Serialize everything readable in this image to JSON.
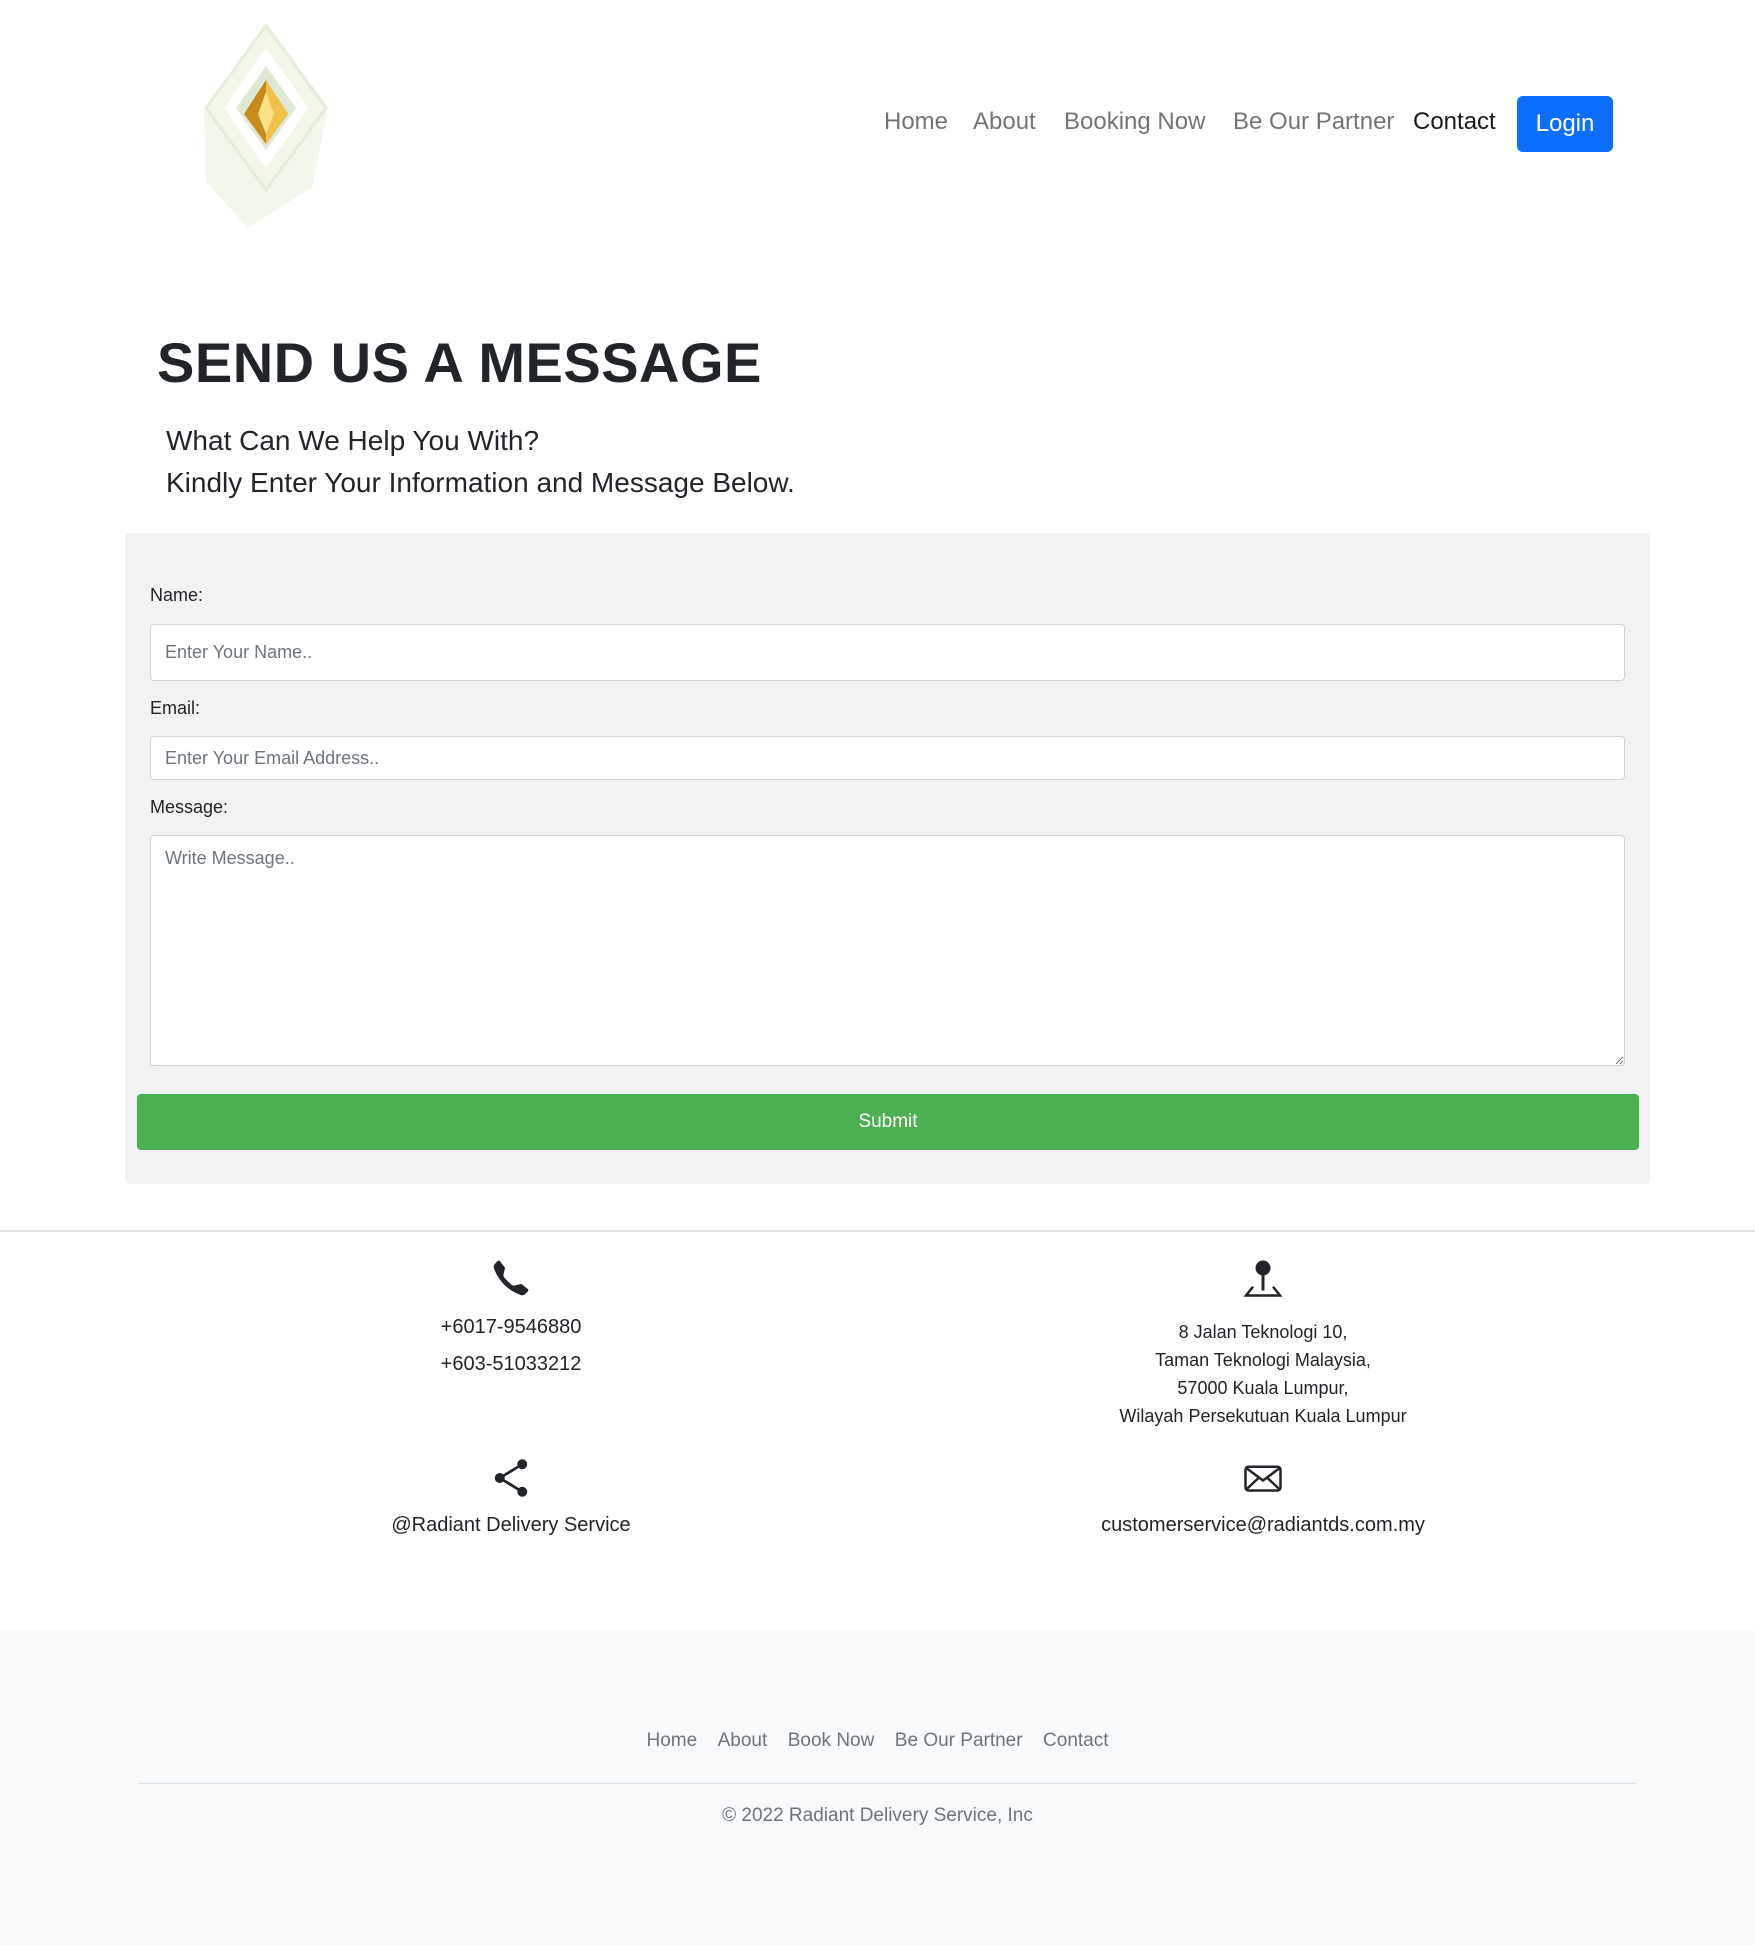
{
  "nav": {
    "home": "Home",
    "about": "About",
    "booking": "Booking Now",
    "partner": "Be Our Partner",
    "contact": "Contact",
    "login": "Login"
  },
  "main": {
    "title": "SEND US A MESSAGE",
    "subtitle_1": "What Can We Help You With?",
    "subtitle_2": "Kindly Enter Your Information and Message Below."
  },
  "form": {
    "name_label": "Name:",
    "name_placeholder": "Enter Your Name..",
    "email_label": "Email:",
    "email_placeholder": "Enter Your Email Address..",
    "message_label": "Message:",
    "message_placeholder": "Write Message..",
    "submit_label": "Submit"
  },
  "contact_info": {
    "phone_1": "+6017-9546880",
    "phone_2": "+603-51033212",
    "address_1": "8 Jalan Teknologi 10,",
    "address_2": "Taman Teknologi Malaysia,",
    "address_3": "57000 Kuala Lumpur,",
    "address_4": "Wilayah Persekutuan Kuala Lumpur",
    "social": "@Radiant Delivery Service",
    "email": "customerservice@radiantds.com.my",
    "icons": [
      "phone-icon",
      "location-pin-icon",
      "share-icon",
      "envelope-icon"
    ]
  },
  "footer": {
    "home": "Home",
    "about": "About",
    "book": "Book Now",
    "partner": "Be Our Partner",
    "contact": "Contact",
    "copyright": "© 2022 Radiant Delivery Service, Inc"
  },
  "colors": {
    "primary": "#0d6efd",
    "submit": "#4caf50",
    "panel": "#f2f2f2",
    "footer_bg": "#f8f9fa"
  }
}
